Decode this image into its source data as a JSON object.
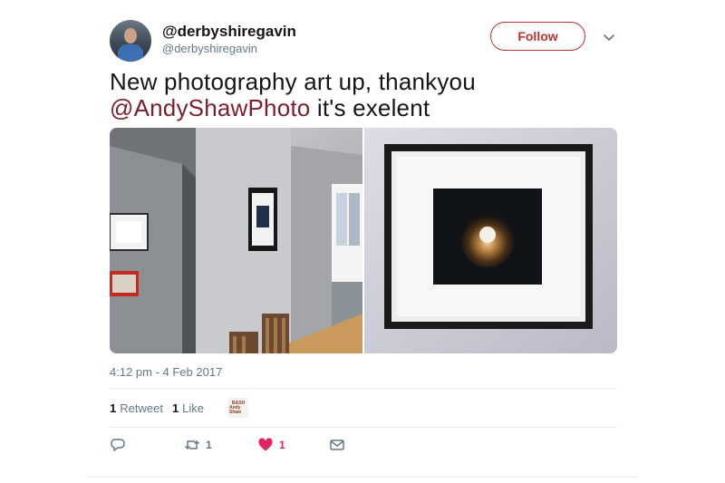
{
  "user": {
    "display_name": "@derbyshiregavin",
    "screen_name": "@derbyshiregavin",
    "avatar_icon": "user-photo"
  },
  "follow_label": "Follow",
  "tweet": {
    "text_before": "New photography art up, thankyou",
    "mention": "@AndyShawPhoto",
    "text_after": " it's exelent"
  },
  "timestamp": "4:12 pm - 4 Feb 2017",
  "stats": {
    "retweet_count": "1",
    "retweet_label": "Retweet",
    "like_count": "1",
    "like_label": "Like"
  },
  "liker": {
    "avatar_text_line1": "BASH",
    "avatar_text_line2": "Andy Shaw"
  },
  "actions": {
    "reply_icon": "reply-icon",
    "retweet_icon": "retweet-icon",
    "retweet_count": "1",
    "like_icon": "heart-icon",
    "like_count": "1",
    "dm_icon": "envelope-icon"
  },
  "colors": {
    "accent": "#c0302e",
    "mention": "#7a1f2b",
    "like": "#e0245e",
    "muted": "#657786"
  }
}
